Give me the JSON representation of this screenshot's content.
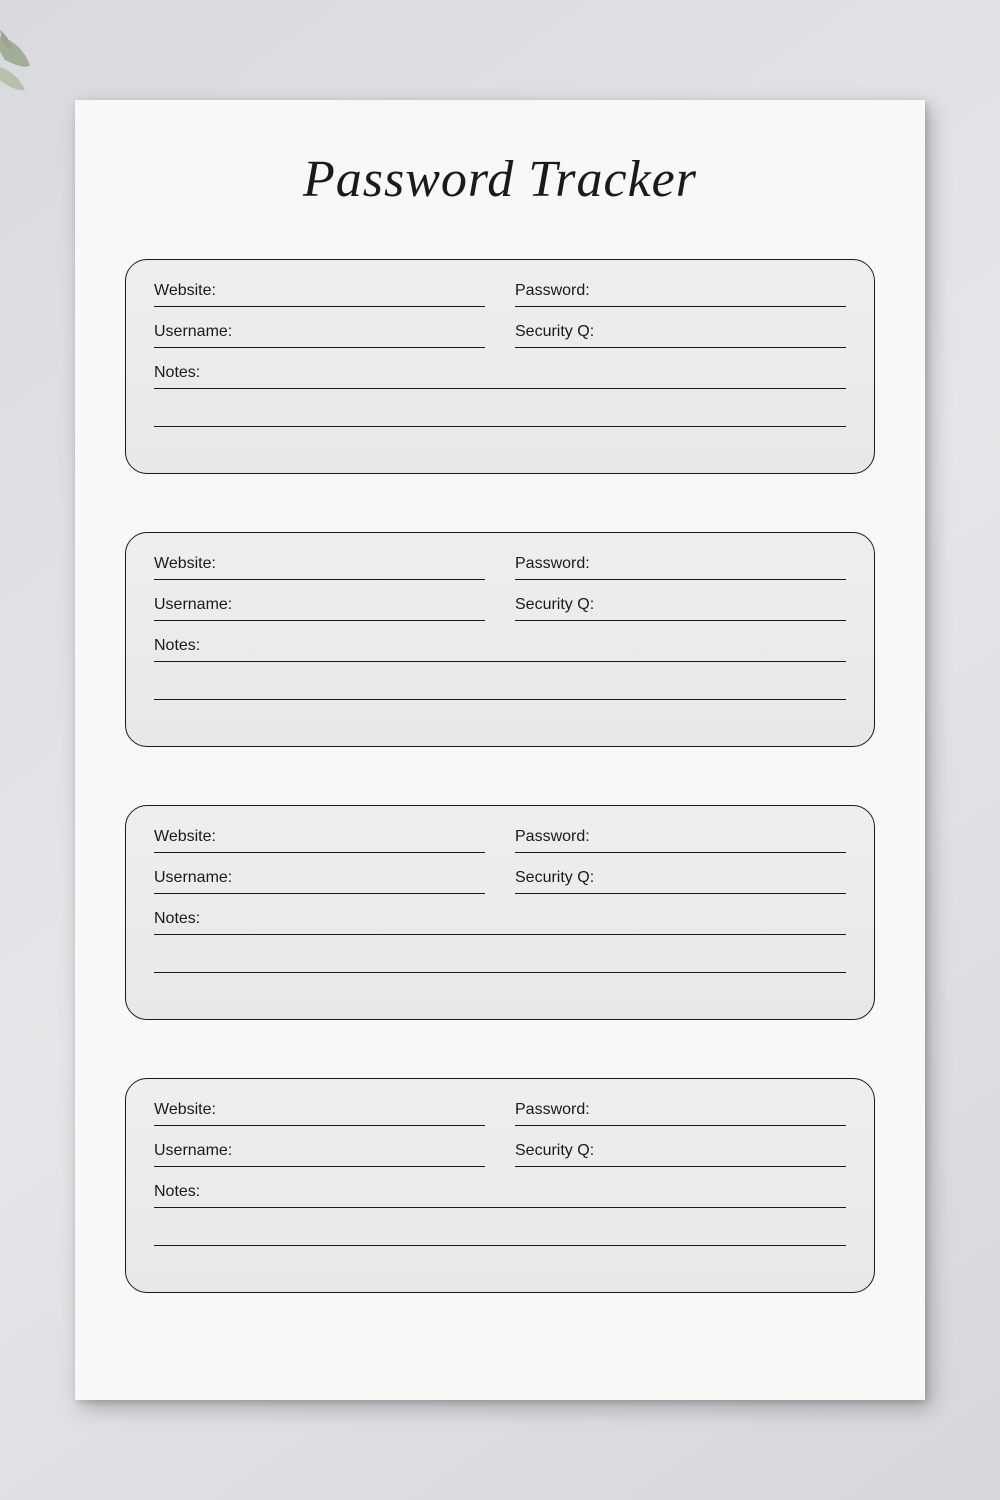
{
  "title": "Password Tracker",
  "labels": {
    "website": "Website:",
    "password": "Password:",
    "username": "Username:",
    "security": "Security Q:",
    "notes": "Notes:"
  },
  "entries": [
    {
      "website": "",
      "password": "",
      "username": "",
      "security": "",
      "notes": ""
    },
    {
      "website": "",
      "password": "",
      "username": "",
      "security": "",
      "notes": ""
    },
    {
      "website": "",
      "password": "",
      "username": "",
      "security": "",
      "notes": ""
    },
    {
      "website": "",
      "password": "",
      "username": "",
      "security": "",
      "notes": ""
    }
  ],
  "decoration": {
    "leaf_colors": [
      "#8a9b7a",
      "#a8b596",
      "#7d8e6c"
    ]
  }
}
